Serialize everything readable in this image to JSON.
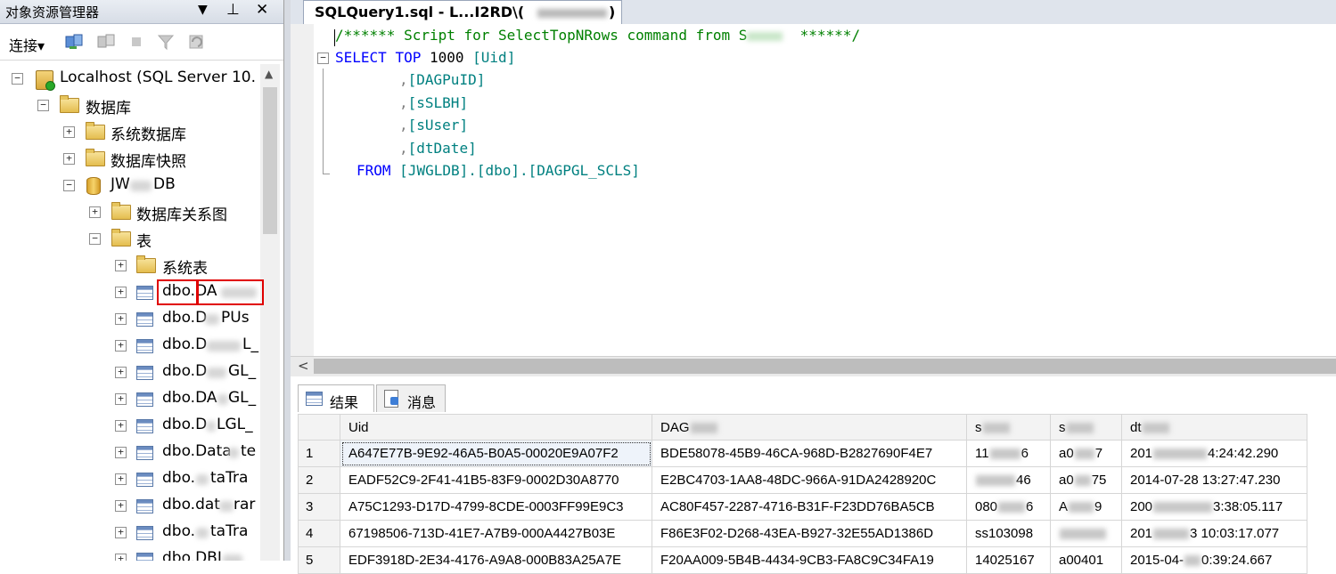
{
  "explorer": {
    "title": "对象资源管理器",
    "pin_glyph": "▼",
    "pin2_glyph": "⊥",
    "close_glyph": "✕",
    "connect_label": "连接▾",
    "tree": [
      {
        "label": "Localhost (SQL Server 10.",
        "type": "server",
        "state": "−"
      },
      {
        "label": "数据库",
        "type": "folder",
        "state": "−"
      },
      {
        "label": "系统数据库",
        "type": "folder",
        "state": "+"
      },
      {
        "label": "数据库快照",
        "type": "folder",
        "state": "+"
      },
      {
        "label": "JW",
        "label_tail": "DB",
        "type": "database",
        "state": "−"
      },
      {
        "label": "数据库关系图",
        "type": "folder",
        "state": "+"
      },
      {
        "label": "表",
        "type": "folder",
        "state": "−"
      },
      {
        "label": "系统表",
        "type": "folder",
        "state": "+"
      },
      {
        "label": "dbo.DA",
        "type": "table",
        "state": "+"
      },
      {
        "label": "dbo.D",
        "label_tail": "PUs",
        "type": "table",
        "state": "+"
      },
      {
        "label": "dbo.D",
        "label_tail": "L_",
        "type": "table",
        "state": "+"
      },
      {
        "label": "dbo.D",
        "label_tail": "GL_",
        "type": "table",
        "state": "+"
      },
      {
        "label": "dbo.DA",
        "label_tail": "GL_",
        "type": "table",
        "state": "+"
      },
      {
        "label": "dbo.D",
        "label_tail": "LGL_",
        "type": "table",
        "state": "+"
      },
      {
        "label": "dbo.Data",
        "label_tail": "te",
        "type": "table",
        "state": "+"
      },
      {
        "label": "dbo.",
        "label_tail": "taTra",
        "type": "table",
        "state": "+"
      },
      {
        "label": "dbo.dat",
        "label_tail": "rar",
        "type": "table",
        "state": "+"
      },
      {
        "label": "dbo.",
        "label_tail": "taTra",
        "type": "table",
        "state": "+"
      },
      {
        "label": "dbo.DBI",
        "type": "table",
        "state": "+"
      }
    ]
  },
  "editor": {
    "tab_label": "SQLQuery1.sql - L...I2RD\\(",
    "tab_tail": ")",
    "code": {
      "comment": "/****** Script for SelectTopNRows command from S",
      "comment_tail": "******/",
      "select_kw": "SELECT",
      "top_kw": "TOP",
      "top_n": "1000",
      "col1": "[Uid]",
      "col2": "[DAGPuID]",
      "col3": "[sSLBH]",
      "col4": "[sUser]",
      "col5": "[dtDate]",
      "from_kw": "FROM",
      "from_obj": "[JWGLDB].[dbo].[DAGPGL_SCLS]",
      "comma": ","
    }
  },
  "results": {
    "tab_results": "结果",
    "tab_messages": "消息",
    "columns": [
      "",
      "Uid",
      "DAG",
      "s",
      "s",
      "dt"
    ],
    "rows": [
      {
        "n": "1",
        "uid": "A647E77B-9E92-46A5-B0A5-00020E9A07F2",
        "dag": "BDE58078-45B9-46CA-968D-B2827690F4E7",
        "s1": "11",
        "s1b": "6",
        "s2": "a0",
        "s2b": "7",
        "dt": "201",
        "dtb": "4:24:42.290"
      },
      {
        "n": "2",
        "uid": "EADF52C9-2F41-41B5-83F9-0002D30A8770",
        "dag": "E2BC4703-1AA8-48DC-966A-91DA2428920C",
        "s1": "",
        "s1b": "46",
        "s2": "a0",
        "s2b": "75",
        "dt": "2014-07-28 13:27:47.230",
        "dtb": ""
      },
      {
        "n": "3",
        "uid": "A75C1293-D17D-4799-8CDE-0003FF99E9C3",
        "dag": "AC80F457-2287-4716-B31F-F23DD76BA5CB",
        "s1": "080",
        "s1b": "6",
        "s2": "A",
        "s2b": "9",
        "dt": "200",
        "dtb": "3:38:05.117"
      },
      {
        "n": "4",
        "uid": "67198506-713D-41E7-A7B9-000A4427B03E",
        "dag": "F86E3F02-D268-43EA-B927-32E55AD1386D",
        "s1": "ss103098",
        "s1b": "",
        "s2": "",
        "s2b": "",
        "dt": "201",
        "dtb": "3 10:03:17.077"
      },
      {
        "n": "5",
        "uid": "EDF3918D-2E34-4176-A9A8-000B83A25A7E",
        "dag": "F20AA009-5B4B-4434-9CB3-FA8C9C34FA19",
        "s1": "14025167",
        "s1b": "",
        "s2": "a00401",
        "s2b": "",
        "dt": "2015-04-",
        "dtb": "0:39:24.667"
      }
    ]
  }
}
